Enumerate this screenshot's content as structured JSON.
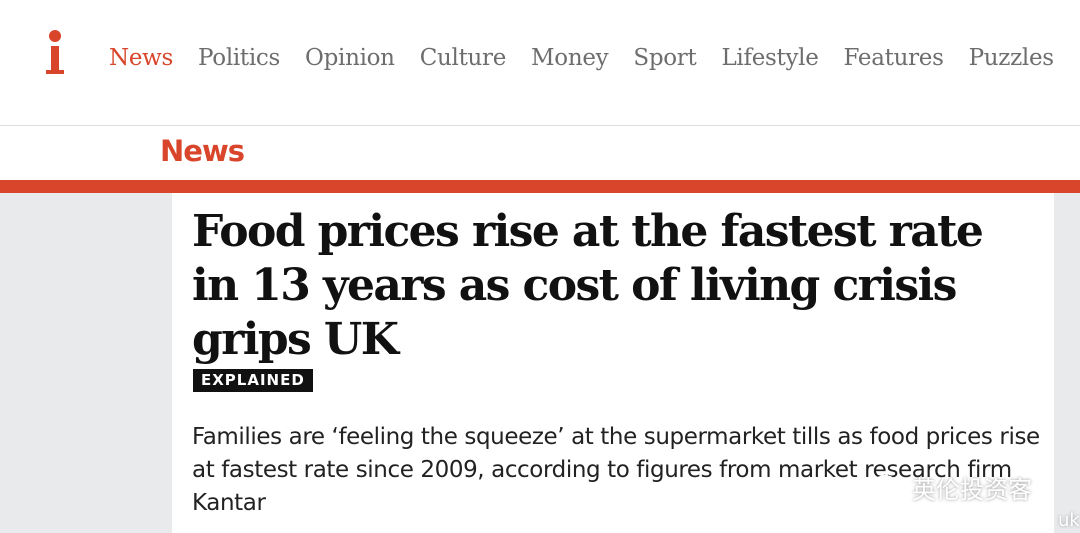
{
  "colors": {
    "brand": "#d8452a",
    "text": "#111111",
    "nav": "#6d6d6d",
    "background": "#e9eaec"
  },
  "header": {
    "logo_text": "i",
    "nav": [
      {
        "label": "News",
        "active": true
      },
      {
        "label": "Politics",
        "active": false
      },
      {
        "label": "Opinion",
        "active": false
      },
      {
        "label": "Culture",
        "active": false
      },
      {
        "label": "Money",
        "active": false
      },
      {
        "label": "Sport",
        "active": false
      },
      {
        "label": "Lifestyle",
        "active": false
      },
      {
        "label": "Features",
        "active": false
      },
      {
        "label": "Puzzles",
        "active": false
      }
    ]
  },
  "section": {
    "label": "News"
  },
  "article": {
    "headline": "Food prices rise at the fastest rate in 13 years as cost of living crisis grips UK",
    "badge": "EXPLAINED",
    "standfirst": "Families are ‘feeling the squeeze’ at the supermarket tills as food prices rise at fastest rate since 2009, according to figures from market research firm Kantar"
  },
  "watermark": {
    "icon": "wechat-icon",
    "text": "英伦投资客",
    "edge_text": "uk"
  }
}
